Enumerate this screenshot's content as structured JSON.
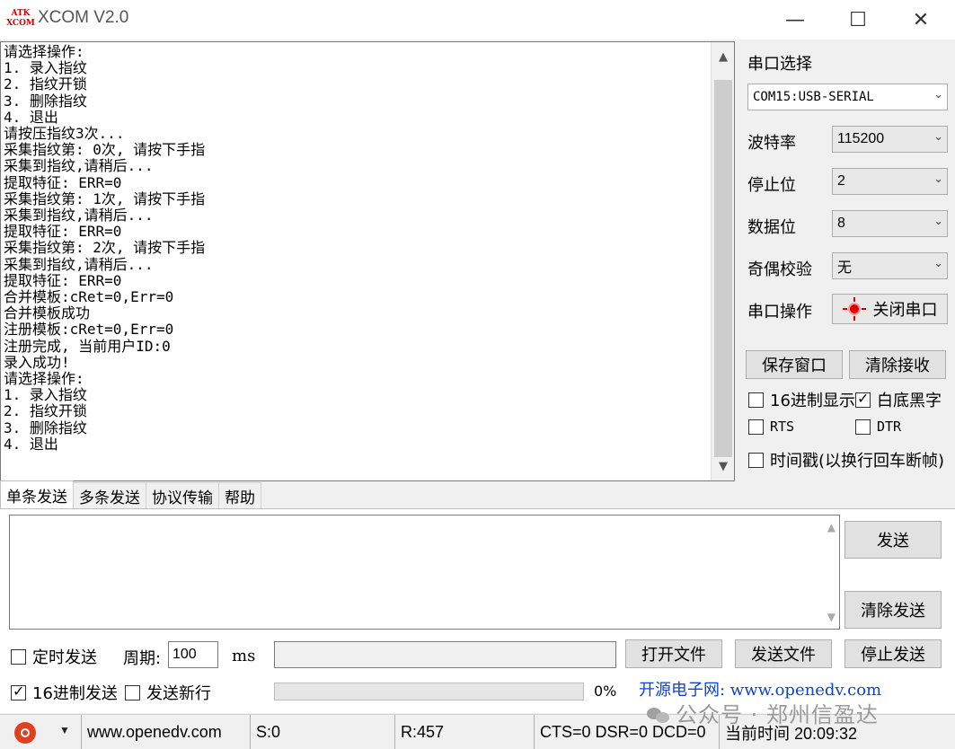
{
  "window": {
    "logo_line1": "ATK",
    "logo_line2": "XCOM",
    "title": "XCOM V2.0",
    "min_glyph": "—",
    "max_glyph": "☐",
    "close_glyph": "✕"
  },
  "receive": {
    "text": "请选择操作:\n1. 录入指纹\n2. 指纹开锁\n3. 删除指纹\n4. 退出\n请按压指纹3次...\n采集指纹第: 0次, 请按下手指\n采集到指纹,请稍后...\n提取特征: ERR=0\n采集指纹第: 1次, 请按下手指\n采集到指纹,请稍后...\n提取特征: ERR=0\n采集指纹第: 2次, 请按下手指\n采集到指纹,请稍后...\n提取特征: ERR=0\n合并模板:cRet=0,Err=0\n合并模板成功\n注册模板:cRet=0,Err=0\n注册完成, 当前用户ID:0\n录入成功!\n请选择操作:\n1. 录入指纹\n2. 指纹开锁\n3. 删除指纹\n4. 退出"
  },
  "serial": {
    "port_select_label": "串口选择",
    "port": "COM15:USB-SERIAL",
    "baud_label": "波特率",
    "baud": "115200",
    "stopbits_label": "停止位",
    "stopbits": "2",
    "databits_label": "数据位",
    "databits": "8",
    "parity_label": "奇偶校验",
    "parity": "无",
    "operation_label": "串口操作",
    "close_port_button": "关闭串口",
    "save_window_button": "保存窗口",
    "clear_receive_button": "清除接收",
    "hex_display_label": "16进制显示",
    "hex_display_checked": false,
    "white_bg_label": "白底黑字",
    "white_bg_checked": true,
    "rts_label": "RTS",
    "rts_checked": false,
    "dtr_label": "DTR",
    "dtr_checked": false,
    "timestamp_label": "时间戳(以换行回车断帧)",
    "timestamp_checked": false,
    "led_color": "#e00000"
  },
  "tabs": [
    "单条发送",
    "多条发送",
    "协议传输",
    "帮助"
  ],
  "send": {
    "text": "",
    "send_button": "发送",
    "clear_send_button": "清除发送",
    "timed_send_label": "定时发送",
    "timed_send_checked": false,
    "period_label": "周期:",
    "period_value": "100",
    "period_unit": "ms",
    "file_path": "",
    "open_file_button": "打开文件",
    "send_file_button": "发送文件",
    "stop_send_button": "停止发送",
    "hex_send_label": "16进制发送",
    "hex_send_checked": true,
    "send_newline_label": "发送新行",
    "send_newline_checked": false,
    "progress_percent": 0,
    "progress_text": "0%",
    "promo_text": "开源电子网: www.openedv.com"
  },
  "status": {
    "url": "www.openedv.com",
    "sent": "S:0",
    "received": "R:457",
    "lines": "CTS=0 DSR=0 DCD=0",
    "time": "当前时间 20:09:32"
  },
  "watermark": "公众号 · 郑州信盈达"
}
